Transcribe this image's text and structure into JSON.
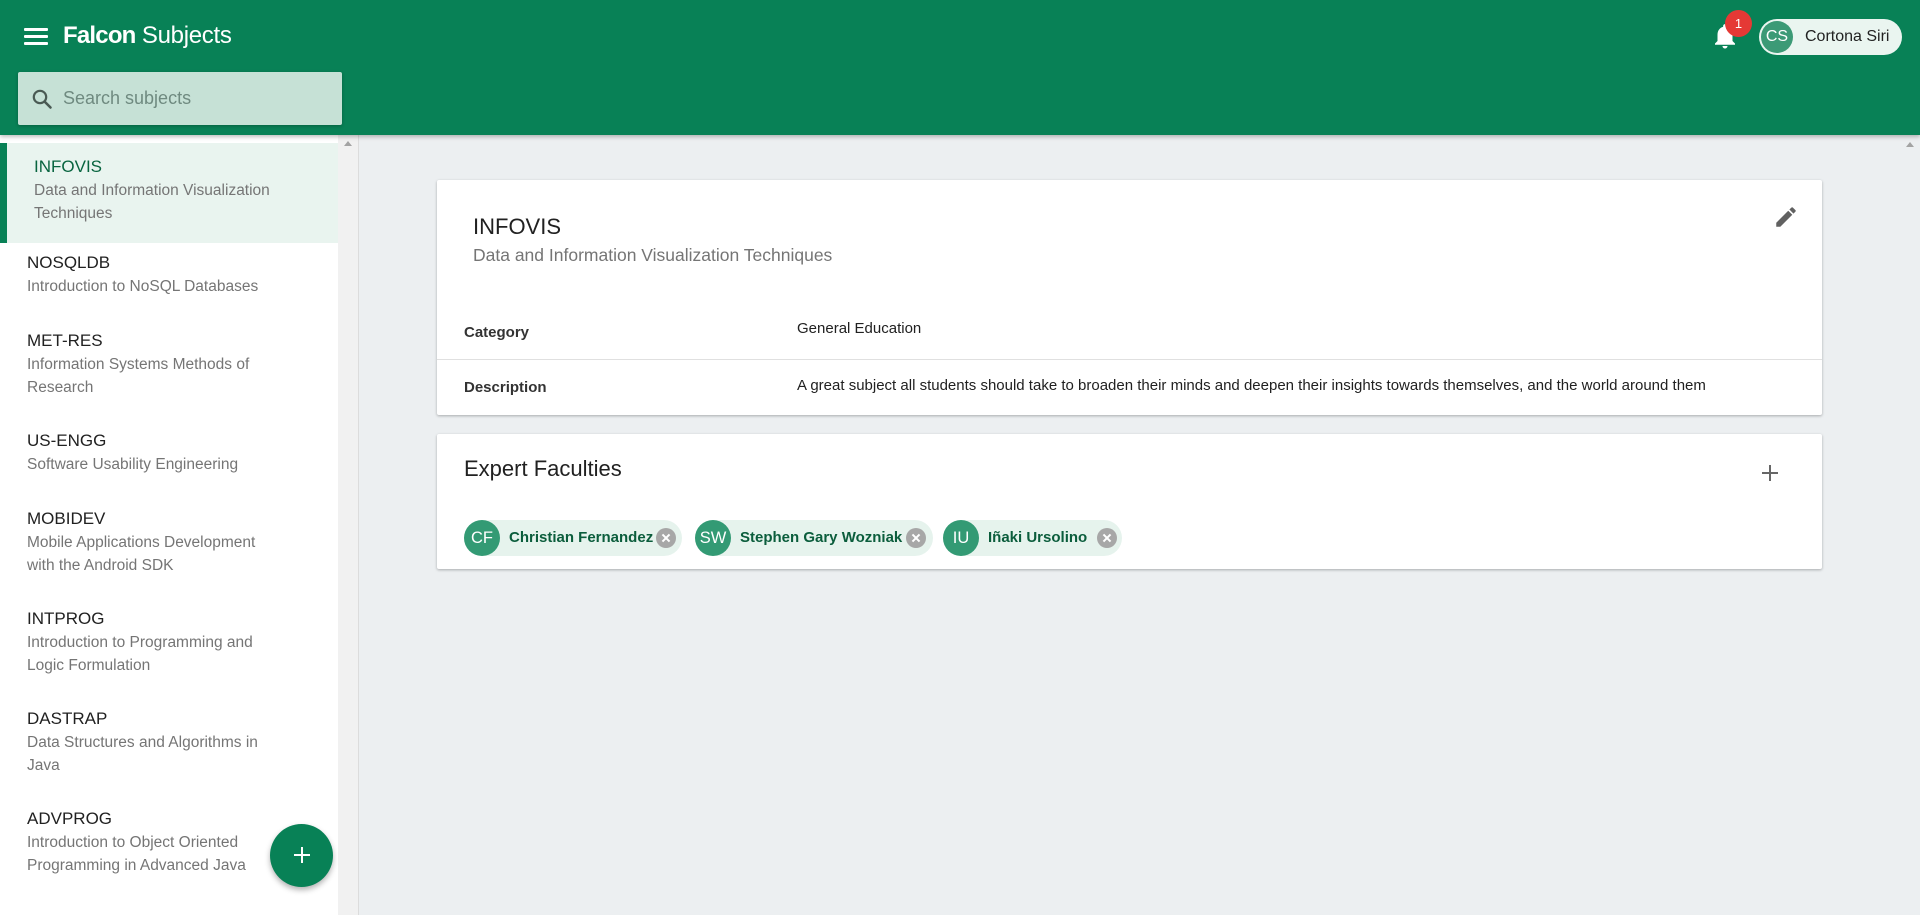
{
  "app": {
    "brand_bold": "Falcon",
    "brand_rest": " Subjects"
  },
  "search": {
    "placeholder": "Search subjects"
  },
  "notifications": {
    "count": "1"
  },
  "user": {
    "initials": "CS",
    "name": "Cortona Siri"
  },
  "sidebar": {
    "items": [
      {
        "code": "INFOVIS",
        "name": "Data and Information Visualization Techniques"
      },
      {
        "code": "NOSQLDB",
        "name": "Introduction to NoSQL Databases"
      },
      {
        "code": "MET-RES",
        "name": "Information Systems Methods of Research"
      },
      {
        "code": "US-ENGG",
        "name": "Software Usability Engineering"
      },
      {
        "code": "MOBIDEV",
        "name": "Mobile Applications Development with the Android SDK"
      },
      {
        "code": "INTPROG",
        "name": "Introduction to Programming and Logic Formulation"
      },
      {
        "code": "DASTRAP",
        "name": "Data Structures and Algorithms in Java"
      },
      {
        "code": "ADVPROG",
        "name": "Introduction to Object Oriented Programming in Advanced Java"
      }
    ]
  },
  "subject": {
    "code": "INFOVIS",
    "title": "Data and Information Visualization Techniques",
    "category_label": "Category",
    "category_value": "General Education",
    "description_label": "Description",
    "description_value": "A great subject all students should take to broaden their minds and deepen their insights towards themselves, and the world around them"
  },
  "faculties": {
    "title": "Expert Faculties",
    "chips": [
      {
        "initials": "CF",
        "name": "Christian Fernandez"
      },
      {
        "initials": "SW",
        "name": "Stephen Gary Wozniak"
      },
      {
        "initials": "IU",
        "name": "Iñaki Ursolino"
      }
    ]
  },
  "colors": {
    "primary": "#088156",
    "active_bg": "#e9f4ef",
    "badge": "#e53935",
    "chip_bg": "#e6f3ed",
    "avatar": "#339a74"
  },
  "icons": [
    "menu-icon",
    "search-icon",
    "bell-icon",
    "edit-icon",
    "plus-icon",
    "close-circle-icon"
  ]
}
